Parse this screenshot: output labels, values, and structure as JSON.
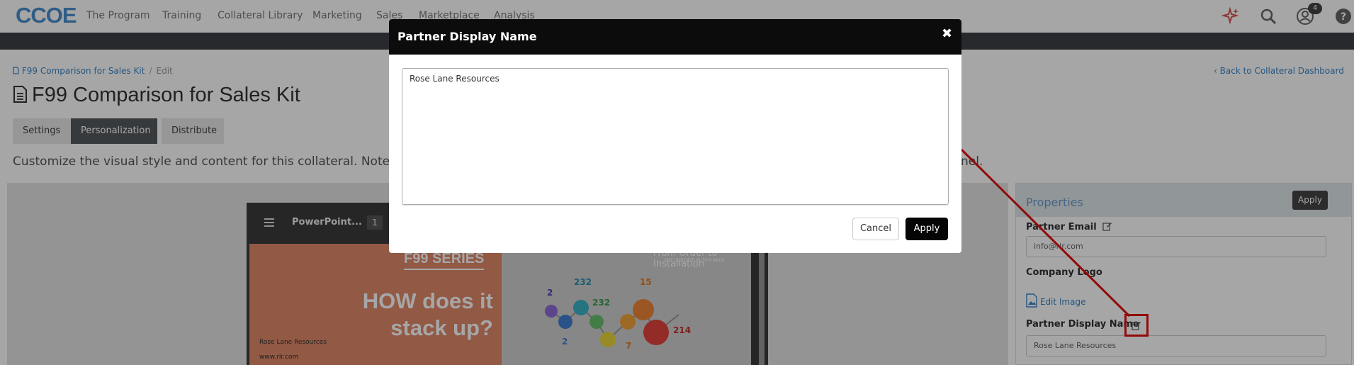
{
  "nav": {
    "logo": "CCOE",
    "items": [
      "The Program",
      "Training",
      "Collateral Library",
      "Marketing",
      "Sales",
      "Marketplace",
      "Analysis"
    ],
    "notification_count": "4"
  },
  "breadcrumb": {
    "parent": "F99 Comparison for Sales Kit",
    "current": "Edit"
  },
  "back_link": "Back to Collateral Dashboard",
  "page_title": "F99 Comparison for Sales Kit",
  "tabs": [
    "Settings",
    "Personalization",
    "Distribute"
  ],
  "description": "Customize the visual style and content for this collateral. Note that",
  "description_tail": "nel.",
  "viewer": {
    "title": "PowerPoint...",
    "page": "1",
    "slide": {
      "series": "F99 SERIES",
      "headline_1": "HOW does it",
      "headline_2": "stack up?",
      "company": "Rose Lane Resources",
      "url": "www.rlr.com",
      "right_heading": "From Order to Installation",
      "right_sub": "THE SUBTITLE IN THIS AREA",
      "numbers": [
        "2",
        "232",
        "232",
        "15",
        "2",
        "7",
        "214"
      ]
    }
  },
  "properties": {
    "title": "Properties",
    "apply_label": "Apply",
    "partner_email_label": "Partner Email",
    "partner_email_value": "info@rlr.com",
    "company_logo_label": "Company Logo",
    "edit_image_label": "Edit Image",
    "partner_name_label": "Partner Display Name",
    "partner_name_value": "Rose Lane Resources"
  },
  "modal": {
    "title": "Partner Display Name",
    "close_glyph": "✖",
    "text_value": "Rose Lane Resources",
    "cancel_label": "Cancel",
    "apply_label": "Apply"
  },
  "colors": {
    "accent": "#3a86c8",
    "modal_header": "#0c0c0c",
    "highlight": "#e01010"
  }
}
